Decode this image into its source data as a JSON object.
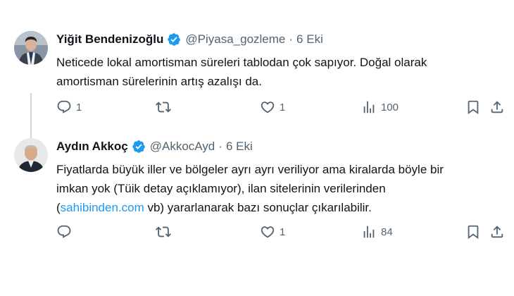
{
  "tweets": [
    {
      "author_name": "Yiğit Bendenizoğlu",
      "handle": "@Piyasa_gozleme",
      "separator": "·",
      "date": "6 Eki",
      "text_lines": [
        "Neticede lokal amortisman süreleri tablodan çok sapıyor. Doğal olarak",
        "amortisman sürelerinin artış azalışı da."
      ],
      "stats": {
        "replies": "1",
        "retweets": "",
        "likes": "1",
        "views": "100"
      }
    },
    {
      "author_name": "Aydın Akkoç",
      "handle": "@AkkocAyd",
      "separator": "·",
      "date": "6 Eki",
      "text_lines": [
        "Fiyatlarda büyük iller ve bölgeler ayrı ayrı veriliyor ama kiralarda böyle bir",
        "imkan yok (Tüik detay açıklamıyor), ilan sitelerinin verilerinden"
      ],
      "line3_prefix": "(",
      "link_text": "sahibinden.com",
      "line3_suffix": " vb) yararlanarak bazı sonuçlar çıkarılabilir.",
      "stats": {
        "replies": "",
        "retweets": "",
        "likes": "1",
        "views": "84"
      }
    }
  ],
  "icons": {
    "verified": "verified-badge-icon",
    "reply": "reply-icon",
    "retweet": "retweet-icon",
    "like": "heart-icon",
    "views": "views-icon",
    "bookmark": "bookmark-icon",
    "share": "share-icon"
  },
  "colors": {
    "accent": "#1d9bf0",
    "text": "#0f1419",
    "muted": "#536471",
    "thread_line": "#cfd9de"
  }
}
